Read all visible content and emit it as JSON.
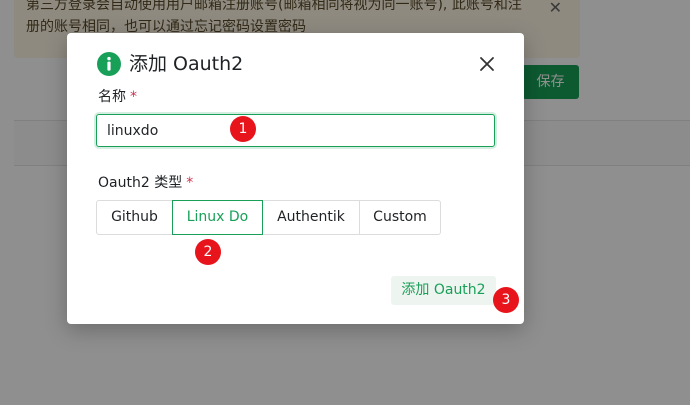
{
  "background": {
    "notice_line1": "第三方登录会自动使用用户邮箱注册账号(邮箱相同将视为同一账号), 此账号和注",
    "notice_line2": "册的账号相同，也可以通过忘记密码设置密码",
    "save_label": "保存"
  },
  "modal": {
    "title": "添加 Oauth2",
    "name_label": "名称",
    "required_mark": "*",
    "name_value": "linuxdo",
    "type_label": "Oauth2 类型",
    "types": [
      "Github",
      "Linux Do",
      "Authentik",
      "Custom"
    ],
    "selected_type": "Linux Do",
    "add_label": "添加 Oauth2"
  },
  "steps": [
    "1",
    "2",
    "3"
  ],
  "colors": {
    "accent": "#18a058",
    "required": "#d03050",
    "marker": "#e8141c"
  }
}
